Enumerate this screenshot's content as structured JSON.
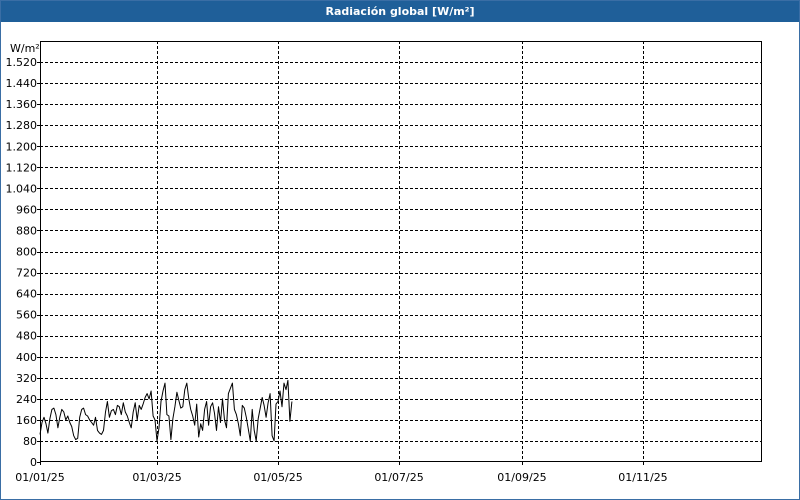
{
  "window": {
    "title": "Radiación global [W/m²]"
  },
  "chart_data": {
    "type": "line",
    "title": "Radiación global [W/m²]",
    "ylabel": "W/m²",
    "xlabel": "",
    "ylim": [
      0,
      1600
    ],
    "xlim": [
      "2025-01-01",
      "2025-12-31"
    ],
    "grid": true,
    "yticks": [
      0,
      80,
      160,
      240,
      320,
      400,
      480,
      560,
      640,
      720,
      800,
      880,
      960,
      1040,
      1120,
      1200,
      1280,
      1360,
      1440,
      1520
    ],
    "yticklabels": [
      "0",
      "80",
      "160",
      "240",
      "320",
      "400",
      "480",
      "560",
      "640",
      "720",
      "800",
      "880",
      "960",
      "1.040",
      "1.120",
      "1.200",
      "1.280",
      "1.360",
      "1.440",
      "1.520"
    ],
    "xticks": [
      "2025-01-01",
      "2025-03-01",
      "2025-05-01",
      "2025-07-01",
      "2025-09-01",
      "2025-11-01"
    ],
    "xticklabels": [
      "01/01/25",
      "01/03/25",
      "01/05/25",
      "01/07/25",
      "01/09/25",
      "01/11/25"
    ],
    "series": [
      {
        "color": "#000000",
        "x": [
          "2025-01-01",
          "2025-01-02",
          "2025-01-03",
          "2025-01-04",
          "2025-01-05",
          "2025-01-06",
          "2025-01-07",
          "2025-01-08",
          "2025-01-09",
          "2025-01-10",
          "2025-01-11",
          "2025-01-12",
          "2025-01-13",
          "2025-01-14",
          "2025-01-15",
          "2025-01-16",
          "2025-01-17",
          "2025-01-18",
          "2025-01-19",
          "2025-01-20",
          "2025-01-21",
          "2025-01-22",
          "2025-01-23",
          "2025-01-24",
          "2025-01-25",
          "2025-01-26",
          "2025-01-27",
          "2025-01-28",
          "2025-01-29",
          "2025-01-30",
          "2025-01-31",
          "2025-02-01",
          "2025-02-02",
          "2025-02-03",
          "2025-02-04",
          "2025-02-05",
          "2025-02-06",
          "2025-02-07",
          "2025-02-08",
          "2025-02-09",
          "2025-02-10",
          "2025-02-11",
          "2025-02-12",
          "2025-02-13",
          "2025-02-14",
          "2025-02-15",
          "2025-02-16",
          "2025-02-17",
          "2025-02-18",
          "2025-02-19",
          "2025-02-20",
          "2025-02-21",
          "2025-02-22",
          "2025-02-23",
          "2025-02-24",
          "2025-02-25",
          "2025-02-26",
          "2025-02-27",
          "2025-02-28",
          "2025-03-01",
          "2025-03-02",
          "2025-03-03",
          "2025-03-04",
          "2025-03-05",
          "2025-03-06",
          "2025-03-07",
          "2025-03-08",
          "2025-03-09",
          "2025-03-10",
          "2025-03-11",
          "2025-03-12",
          "2025-03-13",
          "2025-03-14",
          "2025-03-15",
          "2025-03-16",
          "2025-03-17",
          "2025-03-18",
          "2025-03-19",
          "2025-03-20",
          "2025-03-21",
          "2025-03-22",
          "2025-03-23",
          "2025-03-24",
          "2025-03-25",
          "2025-03-26",
          "2025-03-27",
          "2025-03-28",
          "2025-03-29",
          "2025-03-30",
          "2025-03-31",
          "2025-04-01",
          "2025-04-02",
          "2025-04-03",
          "2025-04-04",
          "2025-04-05",
          "2025-04-06",
          "2025-04-07",
          "2025-04-08",
          "2025-04-09",
          "2025-04-10",
          "2025-04-11",
          "2025-04-12",
          "2025-04-13",
          "2025-04-14",
          "2025-04-15",
          "2025-04-16",
          "2025-04-17",
          "2025-04-18",
          "2025-04-19",
          "2025-04-20",
          "2025-04-21",
          "2025-04-22",
          "2025-04-23",
          "2025-04-24",
          "2025-04-25",
          "2025-04-26",
          "2025-04-27",
          "2025-04-28",
          "2025-04-29",
          "2025-04-30",
          "2025-05-01",
          "2025-05-02",
          "2025-05-03",
          "2025-05-04",
          "2025-05-05",
          "2025-05-06",
          "2025-05-07",
          "2025-05-08"
        ],
        "y": [
          105,
          150,
          170,
          145,
          110,
          165,
          200,
          205,
          180,
          130,
          170,
          200,
          190,
          160,
          175,
          150,
          135,
          100,
          85,
          90,
          170,
          200,
          205,
          180,
          175,
          160,
          150,
          140,
          170,
          120,
          110,
          105,
          120,
          190,
          230,
          170,
          195,
          200,
          180,
          215,
          210,
          180,
          225,
          190,
          175,
          150,
          130,
          190,
          225,
          160,
          215,
          200,
          220,
          245,
          260,
          240,
          270,
          175,
          160,
          80,
          130,
          230,
          270,
          300,
          180,
          175,
          85,
          165,
          210,
          265,
          235,
          205,
          210,
          275,
          300,
          240,
          200,
          175,
          140,
          220,
          95,
          145,
          120,
          200,
          230,
          140,
          210,
          225,
          185,
          120,
          210,
          150,
          240,
          160,
          130,
          260,
          280,
          300,
          200,
          180,
          145,
          100,
          215,
          205,
          170,
          125,
          80,
          200,
          120,
          80,
          165,
          205,
          245,
          215,
          170,
          225,
          260,
          100,
          80,
          220,
          230,
          270,
          210,
          300,
          275,
          310,
          155,
          230
        ]
      }
    ]
  }
}
